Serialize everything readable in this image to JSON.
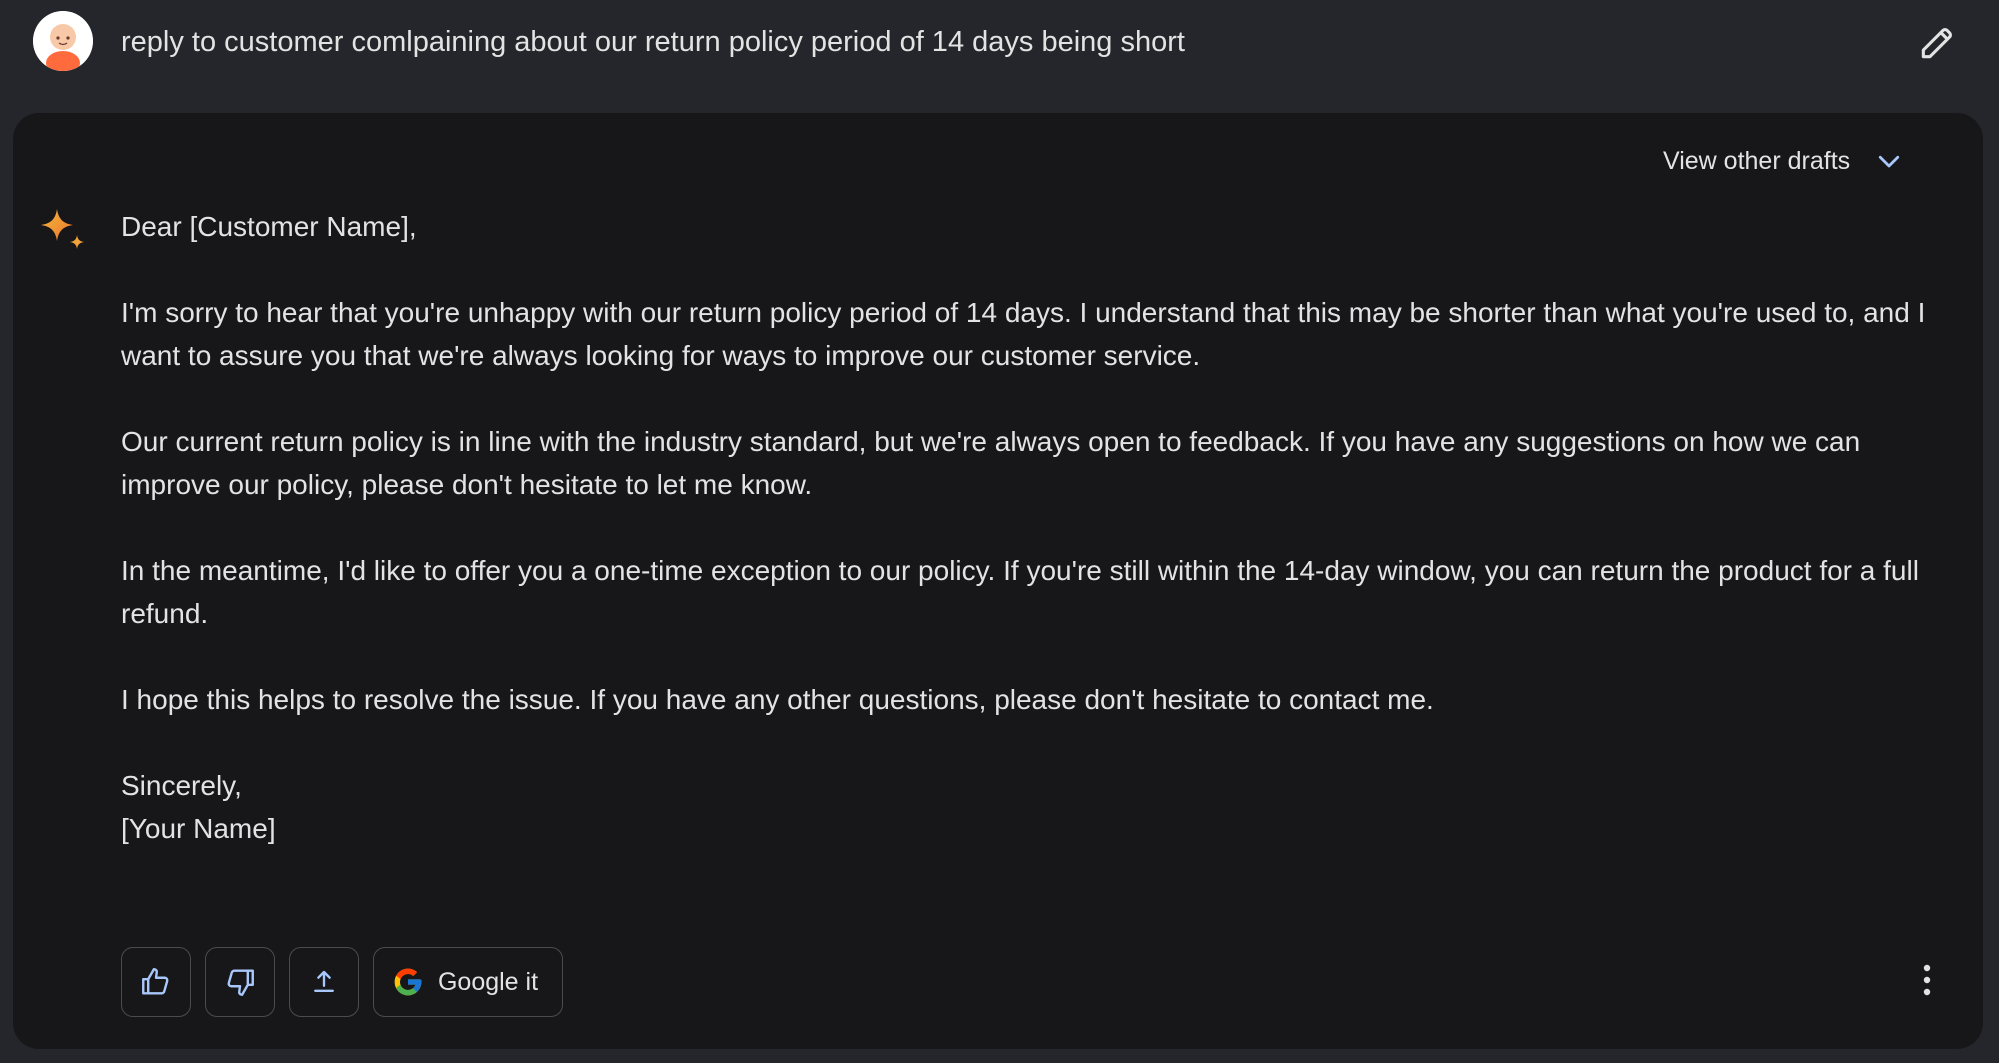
{
  "prompt": {
    "text": "reply to customer comlpaining about our return policy period of 14 days being short"
  },
  "response": {
    "drafts_label": "View other drafts",
    "paragraphs": [
      "Dear [Customer Name],",
      "I'm sorry to hear that you're unhappy with our return policy period of 14 days. I understand that this may be shorter than what you're used to, and I want to assure you that we're always looking for ways to improve our customer service.",
      "Our current return policy is in line with the industry standard, but we're always open to feedback. If you have any suggestions on how we can improve our policy, please don't hesitate to let me know.",
      "In the meantime, I'd like to offer you a one-time exception to our policy. If you're still within the 14-day window, you can return the product for a full refund.",
      "I hope this helps to resolve the issue. If you have any other questions, please don't hesitate to contact me."
    ],
    "closing": "Sincerely,",
    "signature": "[Your Name]"
  },
  "actions": {
    "google_label": "Google it"
  },
  "icons": {
    "avatar": "avatar-icon",
    "edit": "pencil-icon",
    "chevron": "chevron-down-icon",
    "assistant": "sparkle-icon",
    "like": "thumbs-up-icon",
    "dislike": "thumbs-down-icon",
    "share": "share-upload-icon",
    "google": "google-g-icon",
    "more": "more-vertical-icon"
  },
  "colors": {
    "page_bg": "#25262b",
    "card_bg": "#171719",
    "text": "#e3e3e3",
    "accent_chevron": "#a8c7fa",
    "sparkle": "#f29a38"
  }
}
